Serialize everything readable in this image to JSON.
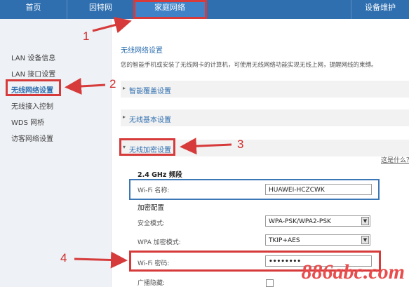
{
  "topnav": {
    "tabs": [
      {
        "label": "首页"
      },
      {
        "label": "因特网"
      },
      {
        "label": "家庭网络"
      },
      {
        "label": "设备维护"
      }
    ],
    "active_index": 2
  },
  "sidebar": {
    "items": [
      {
        "label": "LAN 设备信息"
      },
      {
        "label": "LAN 接口设置"
      },
      {
        "label": "无线网络设置"
      },
      {
        "label": "无线接入控制"
      },
      {
        "label": "WDS 网桥"
      },
      {
        "label": "访客网络设置"
      }
    ],
    "active_index": 2
  },
  "main": {
    "title": "无线网络设置",
    "description": "您的智能手机或安装了无线网卡的计算机，可使用无线网络功能实现无线上网，提醒网线的束缚。",
    "sections": [
      {
        "label": "智能覆盖设置"
      },
      {
        "label": "无线基本设置"
      },
      {
        "label": "无线加密设置"
      }
    ],
    "help_link": "这是什么？",
    "band": "2.4 GHz 频段",
    "wifi_name_label": "Wi-Fi 名称:",
    "wifi_name_value": "HUAWEI-HCZCWK",
    "encrypt_heading": "加密配置",
    "security_mode_label": "安全模式:",
    "security_mode_value": "WPA-PSK/WPA2-PSK",
    "wpa_mode_label": "WPA 加密模式:",
    "wpa_mode_value": "TKIP+AES",
    "wifi_password_label": "Wi-Fi 密码:",
    "wifi_password_value": "••••••••",
    "broadcast_hide_label": "广播隐藏:"
  },
  "annotations": {
    "step_numbers": [
      "1",
      "2",
      "3",
      "4"
    ],
    "highlight_color": "#d63a3a"
  },
  "watermark": "886abc.com"
}
